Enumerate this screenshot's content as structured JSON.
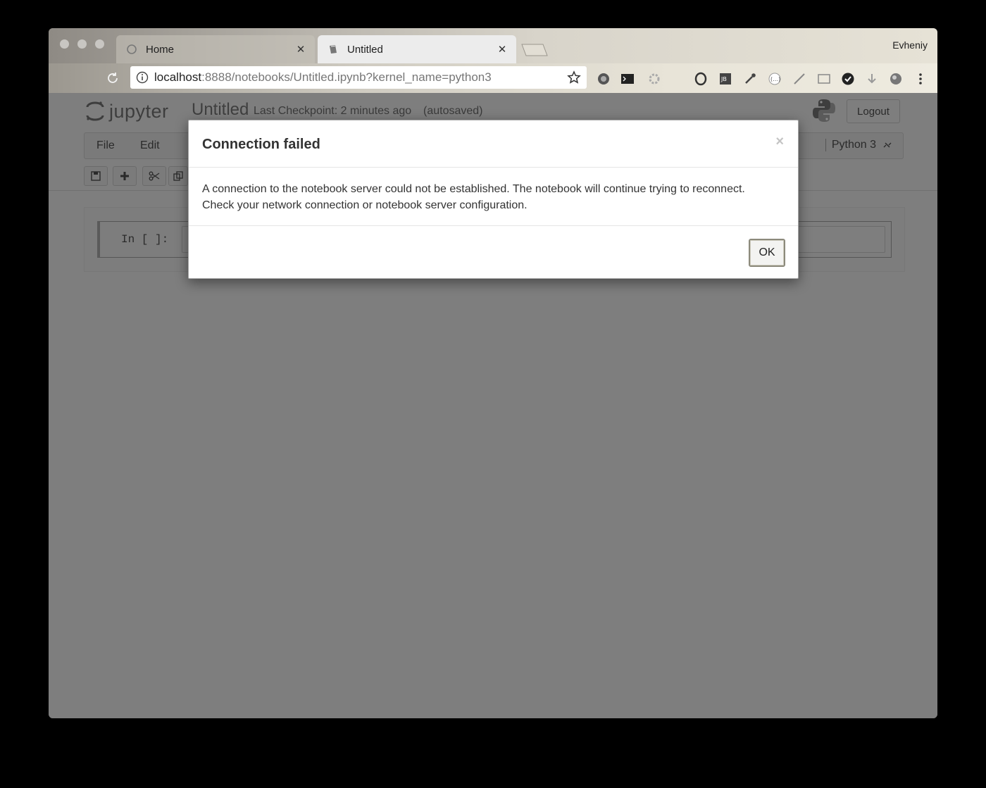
{
  "browser": {
    "profile_name": "Evheniy",
    "tabs": [
      {
        "title": "Home",
        "icon": "jupyter-favicon-icon",
        "active": false
      },
      {
        "title": "Untitled",
        "icon": "notebook-favicon-icon",
        "active": true
      }
    ],
    "url": {
      "host": "localhost",
      "rest": ":8888/notebooks/Untitled.ipynb?kernel_name=python3"
    },
    "extension_icons": [
      "ghostery-icon",
      "terminal-icon",
      "gear-icon",
      "opera-icon",
      "jetbrains-icon",
      "eyedropper-icon",
      "dots-icon",
      "ruler-icon",
      "screen-icon",
      "check-icon",
      "download-icon",
      "globe-icon",
      "menu-icon"
    ]
  },
  "jupyter": {
    "logo_text": "jupyter",
    "notebook_name": "Untitled",
    "checkpoint": "Last Checkpoint: 2 minutes ago",
    "autosave_status": "(autosaved)",
    "logout_label": "Logout",
    "menu": [
      "File",
      "Edit"
    ],
    "kernel_name": "Python 3",
    "cell_prompt": "In [ ]:"
  },
  "dialog": {
    "title": "Connection failed",
    "close_glyph": "×",
    "message_line1": "A connection to the notebook server could not be established. The notebook will continue trying to reconnect.",
    "message_line2": "Check your network connection or notebook server configuration.",
    "ok_label": "OK"
  },
  "colors": {
    "overlay_gray": "#7e7e7e",
    "dialog_bg": "#ffffff",
    "title_text": "#333333"
  }
}
